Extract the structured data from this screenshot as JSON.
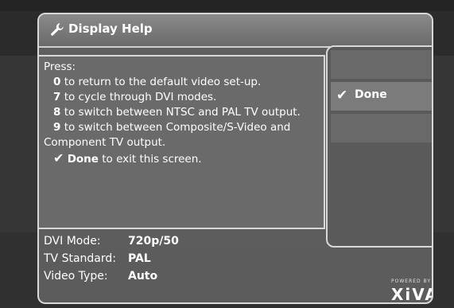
{
  "window": {
    "title": "Display Help",
    "title_icon": "wrench-icon"
  },
  "help": {
    "press_label": "Press:",
    "lines": [
      {
        "key": "0",
        "text": " to return to the default video set-up."
      },
      {
        "key": "7",
        "text": " to cycle through DVI modes."
      },
      {
        "key": "8",
        "text": " to switch between NTSC and PAL TV output."
      },
      {
        "key": "9",
        "text": " to switch between Composite/S-Video and"
      }
    ],
    "continuation": "Component TV output.",
    "done_check": "✔",
    "done_key": "Done",
    "done_text": " to exit this screen."
  },
  "status": {
    "dvi_label": "DVI Mode:",
    "dvi_value": "720p/50",
    "tv_label": "TV Standard:",
    "tv_value": "PAL",
    "video_label": "Video Type:",
    "video_value": "Auto"
  },
  "menu": {
    "done_check": "✔",
    "done_label": "Done"
  },
  "branding": {
    "powered_by": "POWERED BY",
    "logo": "XiVA"
  }
}
